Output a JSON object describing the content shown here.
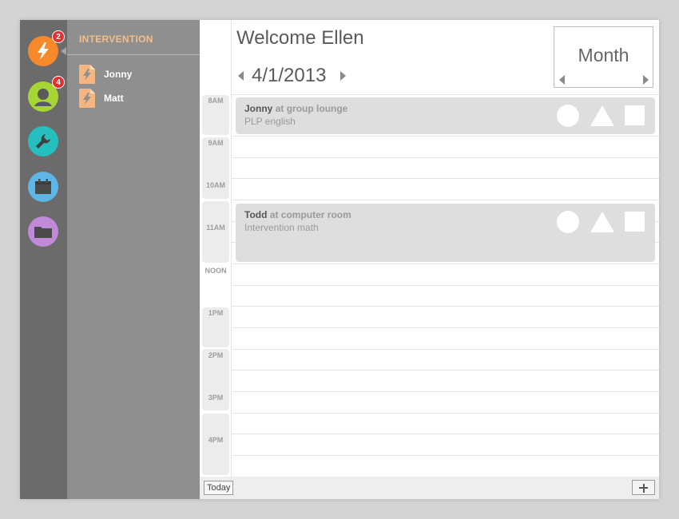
{
  "rail": {
    "items": [
      {
        "icon": "lightning-icon",
        "color": "#f7892a",
        "badge": "2"
      },
      {
        "icon": "person-icon",
        "color": "#a6d635",
        "badge": "4"
      },
      {
        "icon": "wrench-icon",
        "color": "#25bfc0",
        "badge": ""
      },
      {
        "icon": "calendar-icon",
        "color": "#5db6e6",
        "badge": ""
      },
      {
        "icon": "folder-icon",
        "color": "#c08ad9",
        "badge": ""
      }
    ]
  },
  "panel": {
    "title": "INTERVENTION",
    "title_color": "#f3bf8c",
    "items": [
      {
        "name": "Jonny",
        "icon": "lightning-doc-icon"
      },
      {
        "name": "Matt",
        "icon": "lightning-doc-icon"
      }
    ]
  },
  "header": {
    "welcome": "Welcome Ellen",
    "date": "4/1/2013",
    "view_mode": "Month"
  },
  "schedule": {
    "hours": [
      "8AM",
      "9AM",
      "10AM",
      "11AM",
      "NOON",
      "1PM",
      "2PM",
      "3PM",
      "4PM"
    ],
    "events": [
      {
        "who": "Jonny",
        "connector": "at",
        "place": "group lounge",
        "subject": "PLP english"
      },
      {
        "who": "Todd",
        "connector": "at",
        "place": "computer room",
        "subject": "Intervention math"
      }
    ]
  },
  "footer": {
    "today_label": "Today",
    "add_icon": "plus-icon"
  }
}
